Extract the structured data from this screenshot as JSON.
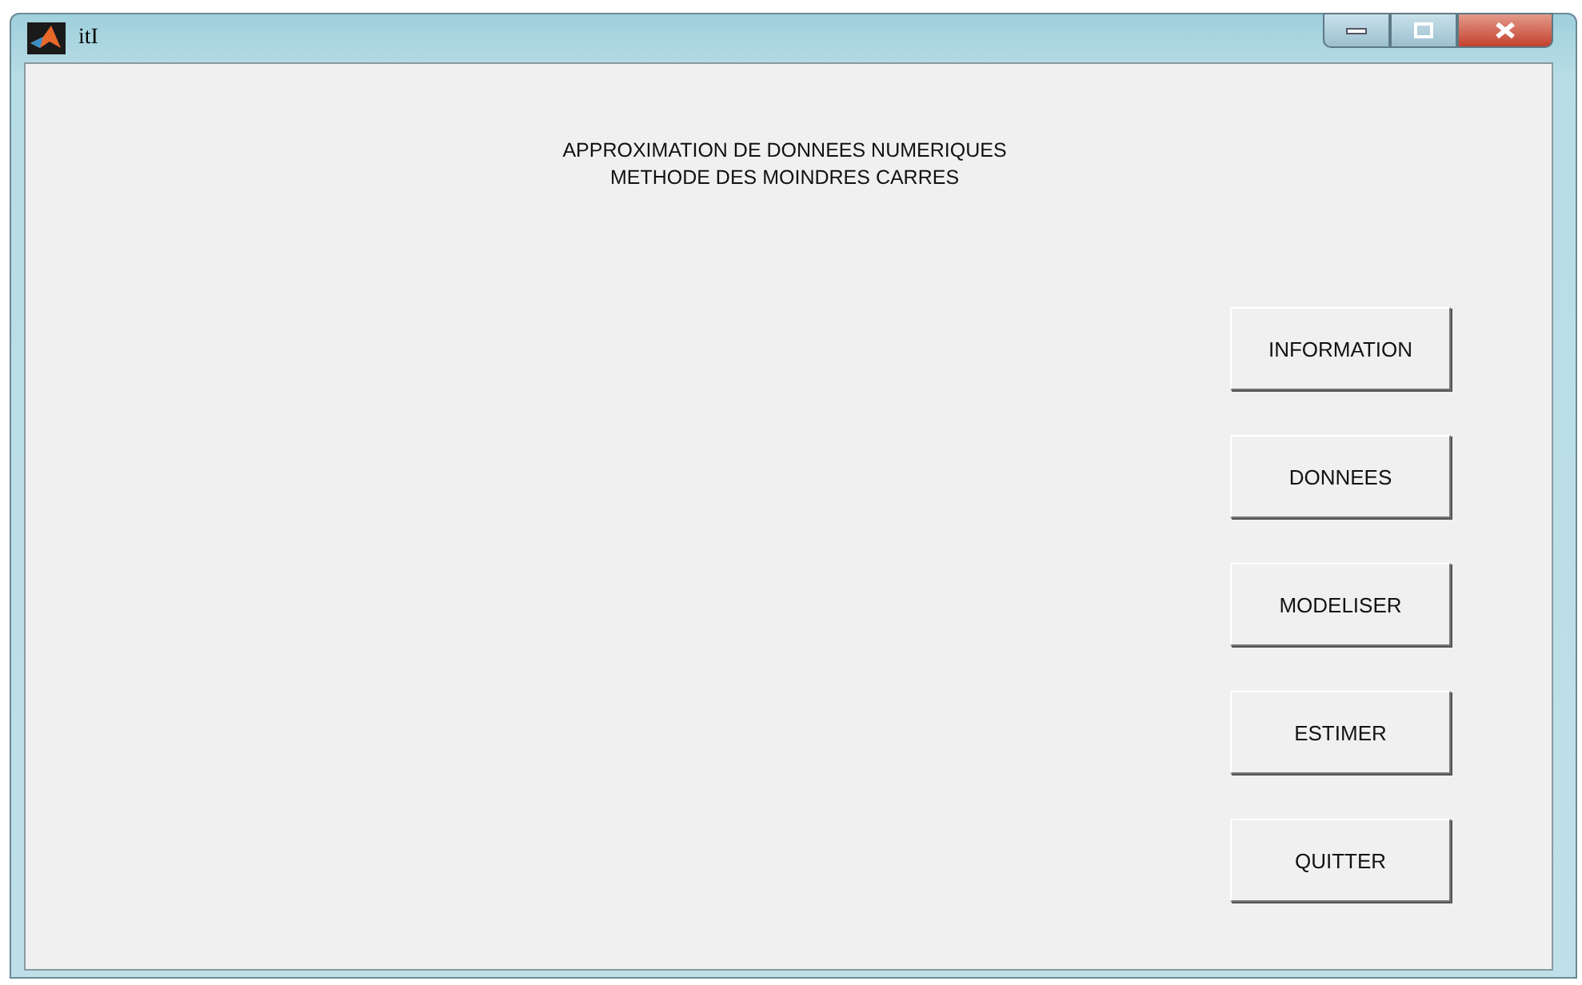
{
  "window": {
    "title": "itI"
  },
  "heading": [
    "APPROXIMATION DE DONNEES NUMERIQUES",
    "METHODE DES MOINDRES CARRES"
  ],
  "buttons": [
    "INFORMATION",
    "DONNEES",
    "MODELISER",
    "ESTIMER",
    "QUITTER"
  ]
}
